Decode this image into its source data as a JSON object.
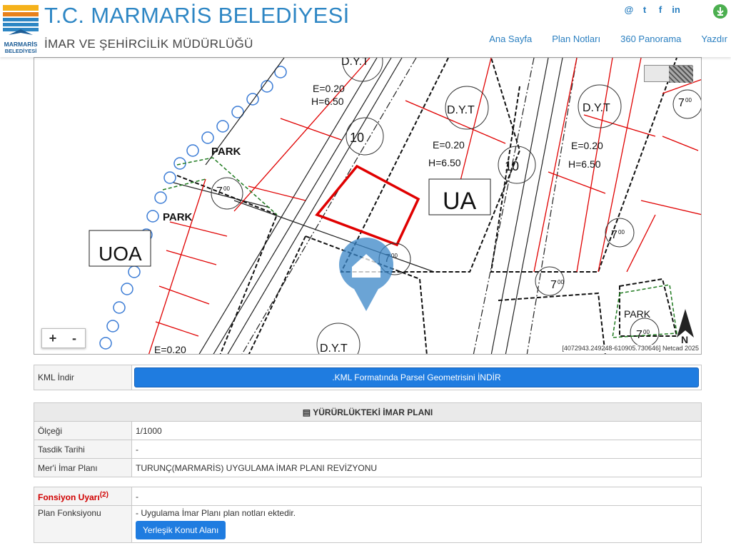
{
  "header": {
    "org_name": "T.C. MARMARİS BELEDİYESİ",
    "org_sub": "İMAR VE ŞEHİRCİLİK MÜDÜRLÜĞÜ",
    "logo_text": "MARMARİS BELEDİYESİ",
    "social": [
      "@",
      "t",
      "f",
      "in"
    ],
    "nav": [
      "Ana Sayfa",
      "Plan Notları",
      "360 Panorama",
      "Yazdır"
    ]
  },
  "map": {
    "labels": {
      "dyt": "D.Y.T",
      "park": "PARK",
      "ua": "UA",
      "uoa": "UOA",
      "e": "E=0.20",
      "h": "H=6.50",
      "seven": "7",
      "ten": "10",
      "zz": "00"
    },
    "zoom_in": "+",
    "zoom_out": "-",
    "coords": "[4072943.249248-610905.730646] Netcad 2025",
    "north": "N"
  },
  "kml": {
    "label": "KML İndir",
    "button": ".KML Formatında Parsel Geometrisini İNDİR"
  },
  "plan": {
    "title": "YÜRÜRLÜKTEKİ İMAR PLANI",
    "rows": [
      {
        "label": "Ölçeği",
        "value": "1/1000"
      },
      {
        "label": "Tasdik Tarihi",
        "value": "-"
      },
      {
        "label": "Mer'i İmar Planı",
        "value": "TURUNÇ(MARMARİS) UYGULAMA İMAR PLANI REVİZYONU"
      }
    ]
  },
  "function": {
    "warning_label": "Fonsiyon Uyarı",
    "warning_sup": "(2)",
    "warning_value": "-",
    "plan_label": "Plan Fonksiyonu",
    "plan_value": "- Uygulama İmar Planı plan notları ektedir.",
    "plan_button": "Yerleşik Konut Alanı"
  },
  "colors": {
    "brand": "#2d86c4",
    "button": "#1f7ce0",
    "warning": "#d00000",
    "parcel": "#e00000"
  }
}
